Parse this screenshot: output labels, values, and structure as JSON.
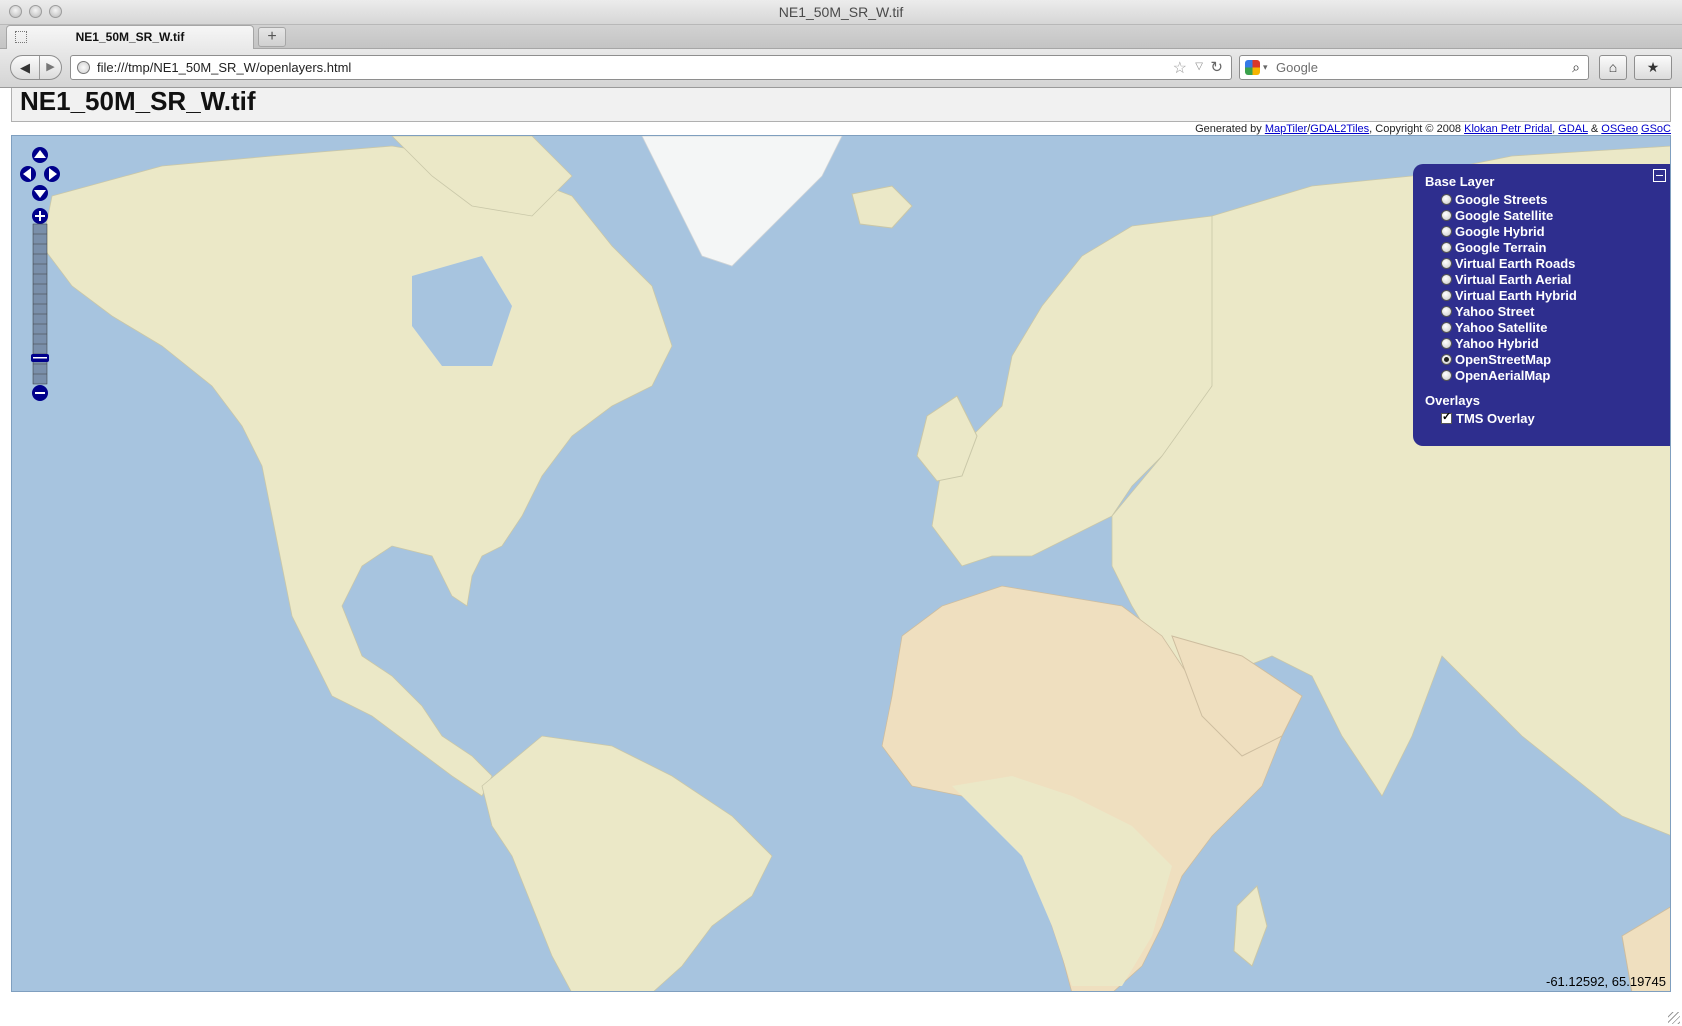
{
  "window": {
    "title": "NE1_50M_SR_W.tif"
  },
  "tab": {
    "label": "NE1_50M_SR_W.tif",
    "new_tab": "+"
  },
  "nav": {
    "back": "◀",
    "forward": "▶",
    "url": "file:///tmp/NE1_50M_SR_W/openlayers.html",
    "search_placeholder": "Google",
    "home": "⌂",
    "bookmarks": "★"
  },
  "page": {
    "heading": "NE1_50M_SR_W.tif"
  },
  "credits": {
    "prefix": "Generated by ",
    "maptiler": "MapTiler",
    "slash": "/",
    "gdal2tiles": "GDAL2Tiles",
    "copyright": ", Copyright © 2008 ",
    "author": "Klokan Petr Pridal",
    "sep1": ", ",
    "gdal": "GDAL",
    "amp": " & ",
    "osgeo": "OSGeo",
    "space": " ",
    "gsoc": "GSoC"
  },
  "map": {
    "mouse_position": "-61.12592, 65.19745",
    "colors": {
      "ocean": "#a7c4df",
      "land": "#ebe8c7",
      "ice": "#f4f6f6",
      "desert": "#efdfbf",
      "switcher": "#2e2e8e"
    }
  },
  "layer_switcher": {
    "base_header": "Base Layer",
    "base_layers": [
      {
        "label": "Google Streets",
        "selected": false
      },
      {
        "label": "Google Satellite",
        "selected": false
      },
      {
        "label": "Google Hybrid",
        "selected": false
      },
      {
        "label": "Google Terrain",
        "selected": false
      },
      {
        "label": "Virtual Earth Roads",
        "selected": false
      },
      {
        "label": "Virtual Earth Aerial",
        "selected": false
      },
      {
        "label": "Virtual Earth Hybrid",
        "selected": false
      },
      {
        "label": "Yahoo Street",
        "selected": false
      },
      {
        "label": "Yahoo Satellite",
        "selected": false
      },
      {
        "label": "Yahoo Hybrid",
        "selected": false
      },
      {
        "label": "OpenStreetMap",
        "selected": true
      },
      {
        "label": "OpenAerialMap",
        "selected": false
      }
    ],
    "overlay_header": "Overlays",
    "overlays": [
      {
        "label": "TMS Overlay",
        "checked": true
      }
    ]
  }
}
